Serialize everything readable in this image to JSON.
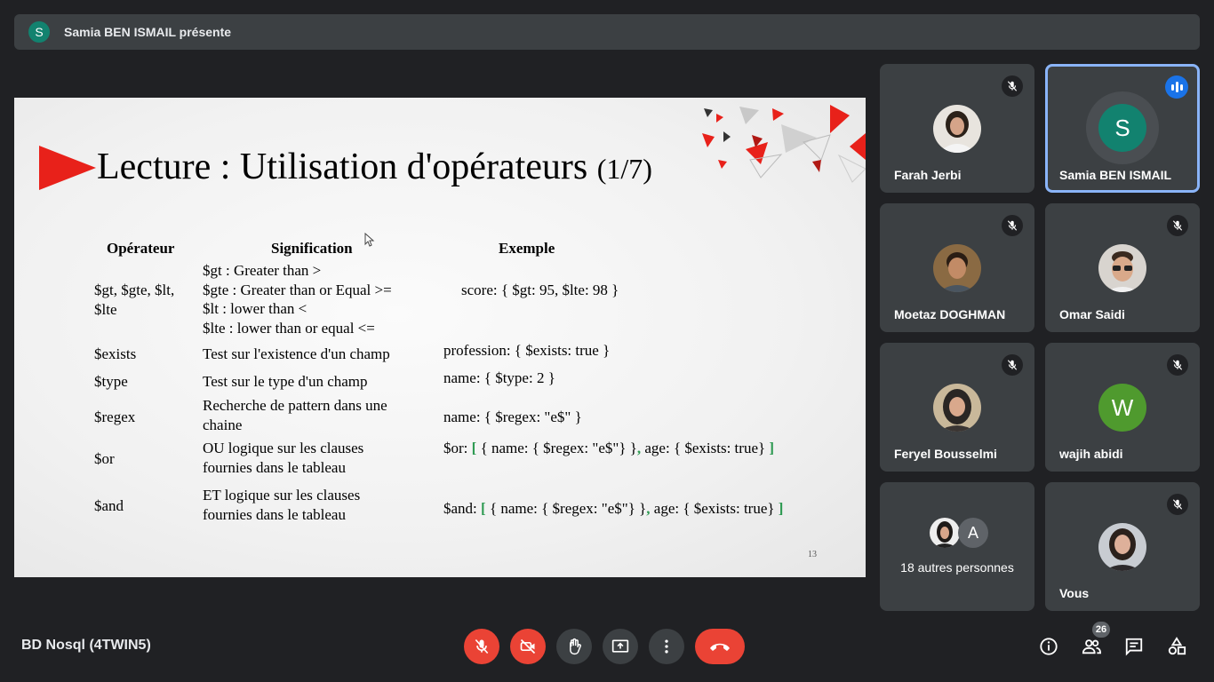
{
  "presenter_banner": {
    "avatar_letter": "S",
    "text": "Samia BEN ISMAIL présente"
  },
  "slide": {
    "title": "Lecture : Utilisation d'opérateurs",
    "title_fraction": "(1/7)",
    "headers": {
      "operator": "Opérateur",
      "meaning": "Signification",
      "example": "Exemple"
    },
    "rows": [
      {
        "op_lines": [
          "$gt, $gte, $lt,",
          "$lte"
        ],
        "meaning_lines": [
          "$gt : Greater than >",
          "$gte : Greater than or Equal >=",
          "$lt : lower than <",
          "$lte : lower than or equal <="
        ],
        "example": "score: { $gt: 95, $lte: 98 }"
      },
      {
        "op_lines": [
          "$exists"
        ],
        "meaning_lines": [
          "Test sur l'existence d'un champ"
        ],
        "example": "profession: { $exists: true }"
      },
      {
        "op_lines": [
          "$type"
        ],
        "meaning_lines": [
          "Test sur le type d'un champ"
        ],
        "example": "name: { $type: 2 }"
      },
      {
        "op_lines": [
          "$regex"
        ],
        "meaning_lines": [
          "Recherche de pattern dans une",
          "chaine"
        ],
        "example": "name: { $regex: \"e$\" }"
      },
      {
        "op_lines": [
          "$or"
        ],
        "meaning_lines": [
          "OU logique sur les clauses",
          "fournies dans le tableau"
        ],
        "example_parts": {
          "prefix": "$or: ",
          "open": "[",
          "part1": " { name: { $regex: \"e$\"} }",
          "comma": ",",
          "part2": " age: { $exists: true} ",
          "close": "]"
        }
      },
      {
        "op_lines": [
          "$and"
        ],
        "meaning_lines": [
          "ET logique sur les clauses",
          "fournies dans le tableau"
        ],
        "example_parts": {
          "prefix": "$and: ",
          "open": "[",
          "part1": " { name: { $regex: \"e$\"} }",
          "comma": ",",
          "part2": " age: { $exists: true} ",
          "close": "]"
        }
      }
    ],
    "page_number": "13",
    "colors": {
      "arrow": "#e8211a",
      "bracket": "#2e9a52"
    }
  },
  "participants": [
    {
      "name": "Farah Jerbi",
      "muted": true,
      "avatar": "photo"
    },
    {
      "name": "Samia BEN ISMAIL",
      "speaking": true,
      "avatar_letter": "S",
      "avatar_color": "#12826f"
    },
    {
      "name": "Moetaz DOGHMAN",
      "muted": true,
      "avatar": "photo"
    },
    {
      "name": "Omar Saidi",
      "muted": true,
      "avatar": "photo"
    },
    {
      "name": "Feryel Bousselmi",
      "muted": true,
      "avatar": "photo"
    },
    {
      "name": "wajih abidi",
      "muted": true,
      "avatar_letter": "W",
      "avatar_color": "#4f9a2e"
    },
    {
      "name": "18 autres personnes",
      "avatar_letter": "A",
      "avatar_color": "#5f6368"
    },
    {
      "name": "Vous",
      "muted": true,
      "avatar": "photo"
    }
  ],
  "bottom_bar": {
    "meeting_name": "BD Nosql (4TWIN5)",
    "controls": [
      "mic-off-icon",
      "camera-off-icon",
      "raise-hand-icon",
      "present-icon",
      "more-options-icon",
      "end-call-icon"
    ],
    "right_icons": [
      "info-icon",
      "people-icon",
      "chat-icon",
      "activities-icon"
    ],
    "participant_count": "26"
  }
}
